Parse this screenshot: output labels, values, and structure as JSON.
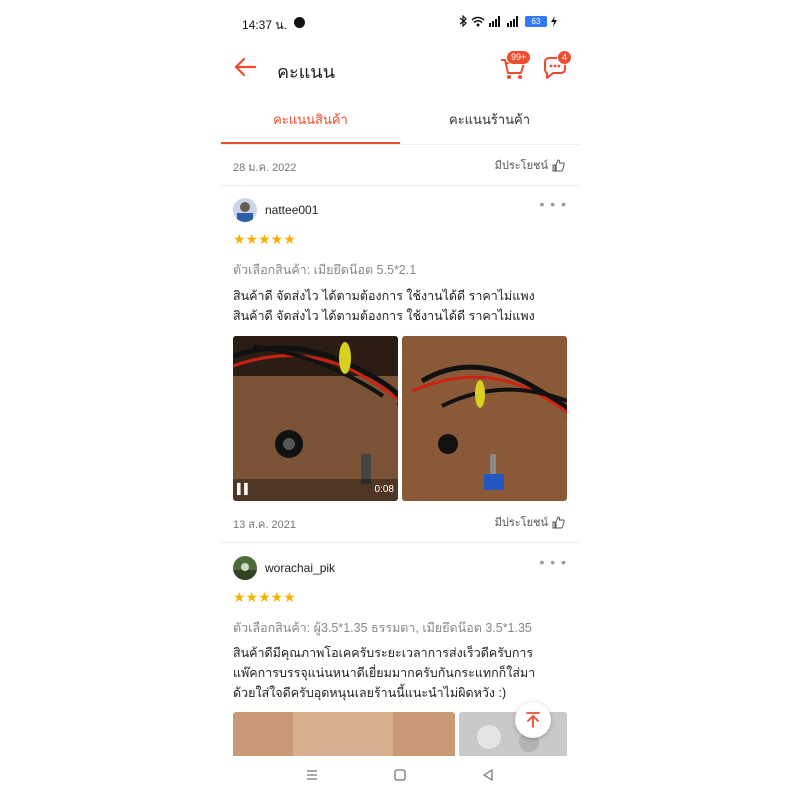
{
  "status_bar": {
    "time": "14:37 น.",
    "battery": "63"
  },
  "header": {
    "title": "คะแนน",
    "cart_badge": "99+",
    "chat_badge": "4"
  },
  "tabs": [
    {
      "label": "คะแนนสินค้า"
    },
    {
      "label": "คะแนนร้านค้า"
    }
  ],
  "helpful_label": "มีประโยชน์",
  "reviews": [
    {
      "date": "28 ม.ค. 2022",
      "username": "nattee001",
      "stars": "★★★★★",
      "variant": "ตัวเลือกสินค้า: เมียยึดน๊อต 5.5*2.1",
      "text_lines": [
        "สินค้าดี จัดส่งไว ได้ตามต้องการ ใช้งานได้ดี ราคาไม่แพง",
        "สินค้าดี จัดส่งไว ได้ตามต้องการ ใช้งานได้ดี ราคาไม่แพง"
      ],
      "video_duration": "0:08"
    },
    {
      "date": "13 ส.ค. 2021",
      "username": "worachai_pik",
      "stars": "★★★★★",
      "variant": "ตัวเลือกสินค้า: ผู้3.5*1.35 ธรรมดา, เมียยึดน๊อต 3.5*1.35",
      "text_lines": [
        "สินค้าดีมีคุณภาพโอเคครับระยะเวลาการส่งเร็วดีครับการ",
        "แพ๊คการบรรจุแน่นหนาดีเยี่ยมมากครับกันกระแทกก็ใส่มา",
        "ด้วยใส่ใจดีครับอุดหนุนเลยร้านนี้แนะนำไม่ผิดหวัง :)"
      ]
    }
  ],
  "colors": {
    "accent": "#ee4d2d",
    "star": "#f5b301"
  }
}
